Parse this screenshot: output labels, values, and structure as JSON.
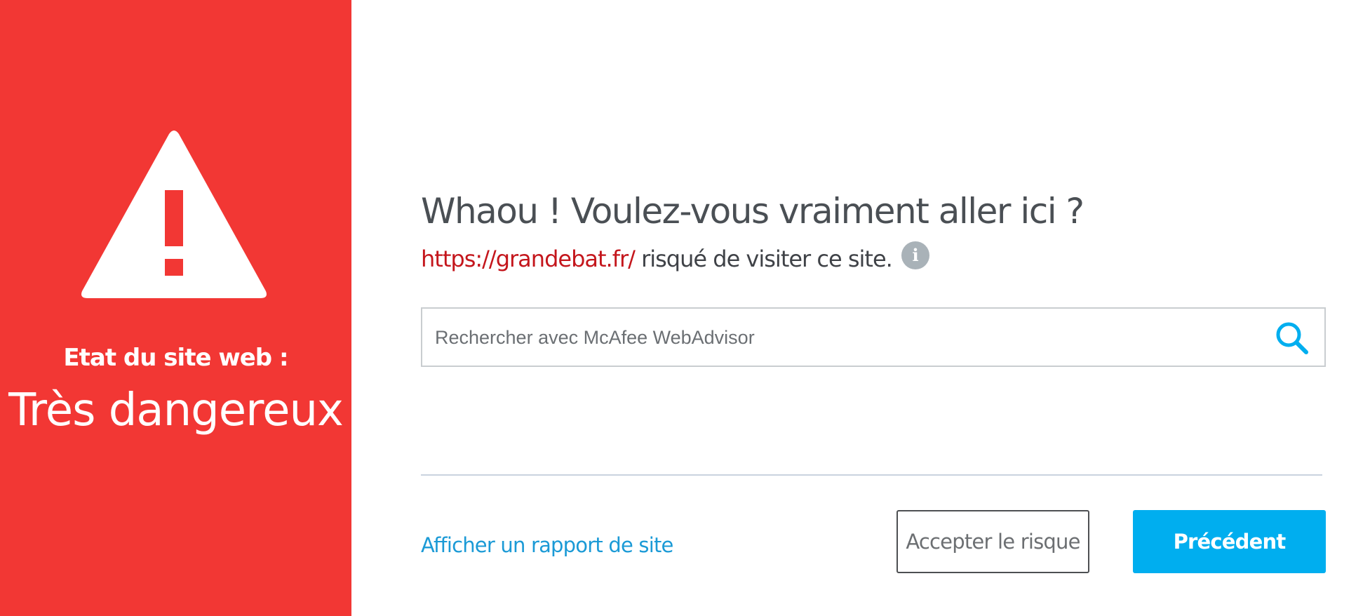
{
  "left_panel": {
    "status_label": "Etat du site web :",
    "status_value": "Très dangereux",
    "icon": "warning-triangle-icon",
    "background_color": "#f23734"
  },
  "main": {
    "headline": "Whaou ! Voulez-vous vraiment aller ici ?",
    "url": "https://grandebat.fr/",
    "risk_text": " risqué de visiter ce site.",
    "info_icon_glyph": "i",
    "search": {
      "placeholder": "Rechercher avec McAfee WebAdvisor",
      "value": "",
      "icon": "search-icon"
    },
    "report_link": "Afficher un rapport de site",
    "accept_button": "Accepter le risque",
    "back_button": "Précédent"
  },
  "colors": {
    "danger": "#f23734",
    "url": "#c4161c",
    "accent": "#00aeef",
    "link": "#1b9ad6"
  }
}
